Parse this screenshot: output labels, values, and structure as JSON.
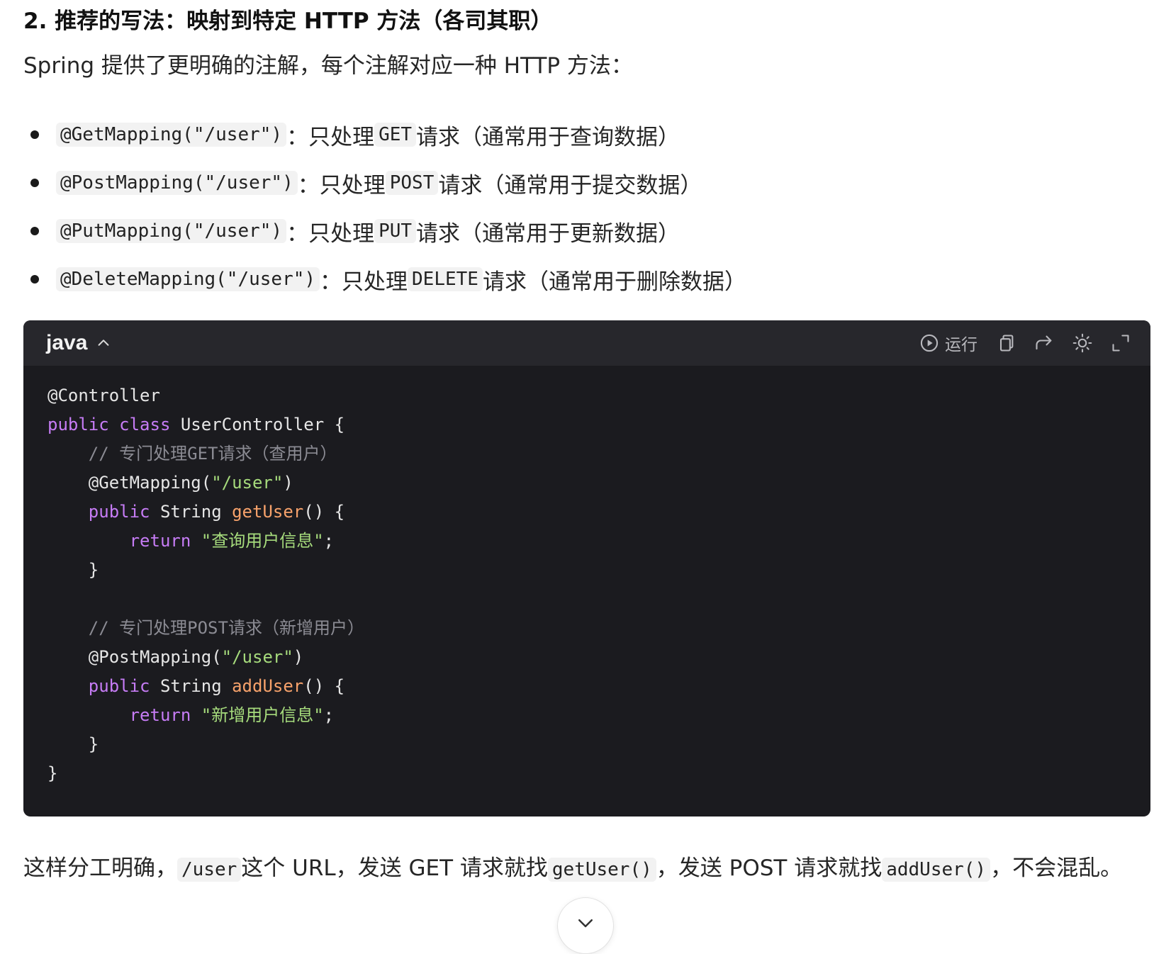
{
  "heading": "2. 推荐的写法：映射到特定 HTTP 方法（各司其职）",
  "intro": "Spring 提供了更明确的注解，每个注解对应一种 HTTP 方法：",
  "bullets": [
    {
      "code": "@GetMapping(\"/user\")",
      "sep": "：",
      "pre": "只处理",
      "method": "GET",
      "post": "请求（通常用于查询数据）"
    },
    {
      "code": "@PostMapping(\"/user\")",
      "sep": "：",
      "pre": "只处理",
      "method": "POST",
      "post": "请求（通常用于提交数据）"
    },
    {
      "code": "@PutMapping(\"/user\")",
      "sep": "：",
      "pre": "只处理",
      "method": "PUT",
      "post": "请求（通常用于更新数据）"
    },
    {
      "code": "@DeleteMapping(\"/user\")",
      "sep": "：",
      "pre": "只处理",
      "method": "DELETE",
      "post": "请求（通常用于删除数据）"
    }
  ],
  "code_block": {
    "language": "java",
    "toolbar": {
      "run_label": "运行"
    },
    "lines": {
      "l1": "@Controller",
      "l2_kw1": "public",
      "l2_kw2": "class",
      "l2_rest": "UserController {",
      "l3": "// 专门处理GET请求（查用户）",
      "l4_ann": "@GetMapping(",
      "l4_str": "\"/user\"",
      "l4_end": ")",
      "l5_kw": "public",
      "l5_type": "String",
      "l5_fn": "getUser",
      "l5_end": "() {",
      "l6_kw": "return",
      "l6_str": "\"查询用户信息\"",
      "l6_end": ";",
      "l7": "}",
      "l9": "// 专门处理POST请求（新增用户）",
      "l10_ann": "@PostMapping(",
      "l10_str": "\"/user\"",
      "l10_end": ")",
      "l11_kw": "public",
      "l11_type": "String",
      "l11_fn": "addUser",
      "l11_end": "() {",
      "l12_kw": "return",
      "l12_str": "\"新增用户信息\"",
      "l12_end": ";",
      "l13": "}",
      "l14": "}"
    }
  },
  "summary": {
    "p1": "这样分工明确，",
    "c1": "/user",
    "p2": "这个 URL，发送 GET 请求就找",
    "c2": "getUser()",
    "p3": "，发送 POST 请求就找",
    "c3": "addUser()",
    "p4": "，不会混乱。"
  },
  "colors": {
    "code_bg": "#1b1b1f",
    "code_header_bg": "#27272c",
    "keyword": "#c67cf5",
    "function": "#f7a26b",
    "string": "#a6db7c",
    "comment": "#8b8b93"
  }
}
